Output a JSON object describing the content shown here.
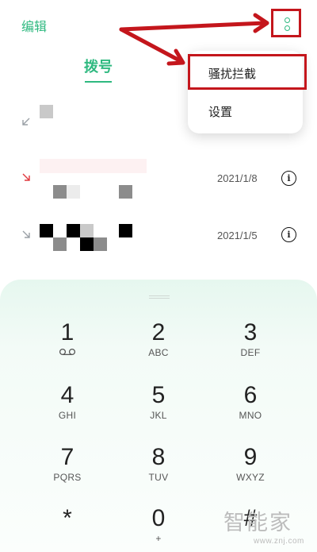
{
  "header": {
    "edit_label": "编辑",
    "more_icon": "more-vertical-icon",
    "tab_dial": "拨号"
  },
  "menu": {
    "items": [
      {
        "label": "骚扰拦截"
      },
      {
        "label": "设置"
      }
    ]
  },
  "calls": [
    {
      "type": "outgoing",
      "date": ""
    },
    {
      "type": "missed",
      "date": "2021/1/8"
    },
    {
      "type": "incoming",
      "date": "2021/1/5"
    }
  ],
  "dialpad": {
    "keys": [
      {
        "digit": "1",
        "letters": ""
      },
      {
        "digit": "2",
        "letters": "ABC"
      },
      {
        "digit": "3",
        "letters": "DEF"
      },
      {
        "digit": "4",
        "letters": "GHI"
      },
      {
        "digit": "5",
        "letters": "JKL"
      },
      {
        "digit": "6",
        "letters": "MNO"
      },
      {
        "digit": "7",
        "letters": "PQRS"
      },
      {
        "digit": "8",
        "letters": "TUV"
      },
      {
        "digit": "9",
        "letters": "WXYZ"
      },
      {
        "digit": "*",
        "letters": ""
      },
      {
        "digit": "0",
        "letters": "+"
      },
      {
        "digit": "#",
        "letters": ""
      }
    ]
  },
  "watermark": {
    "logo": "智能家",
    "url": "www.znj.com"
  },
  "colors": {
    "accent": "#2fb980",
    "annotation_red": "#c4161c",
    "missed_red": "#e0383e"
  }
}
